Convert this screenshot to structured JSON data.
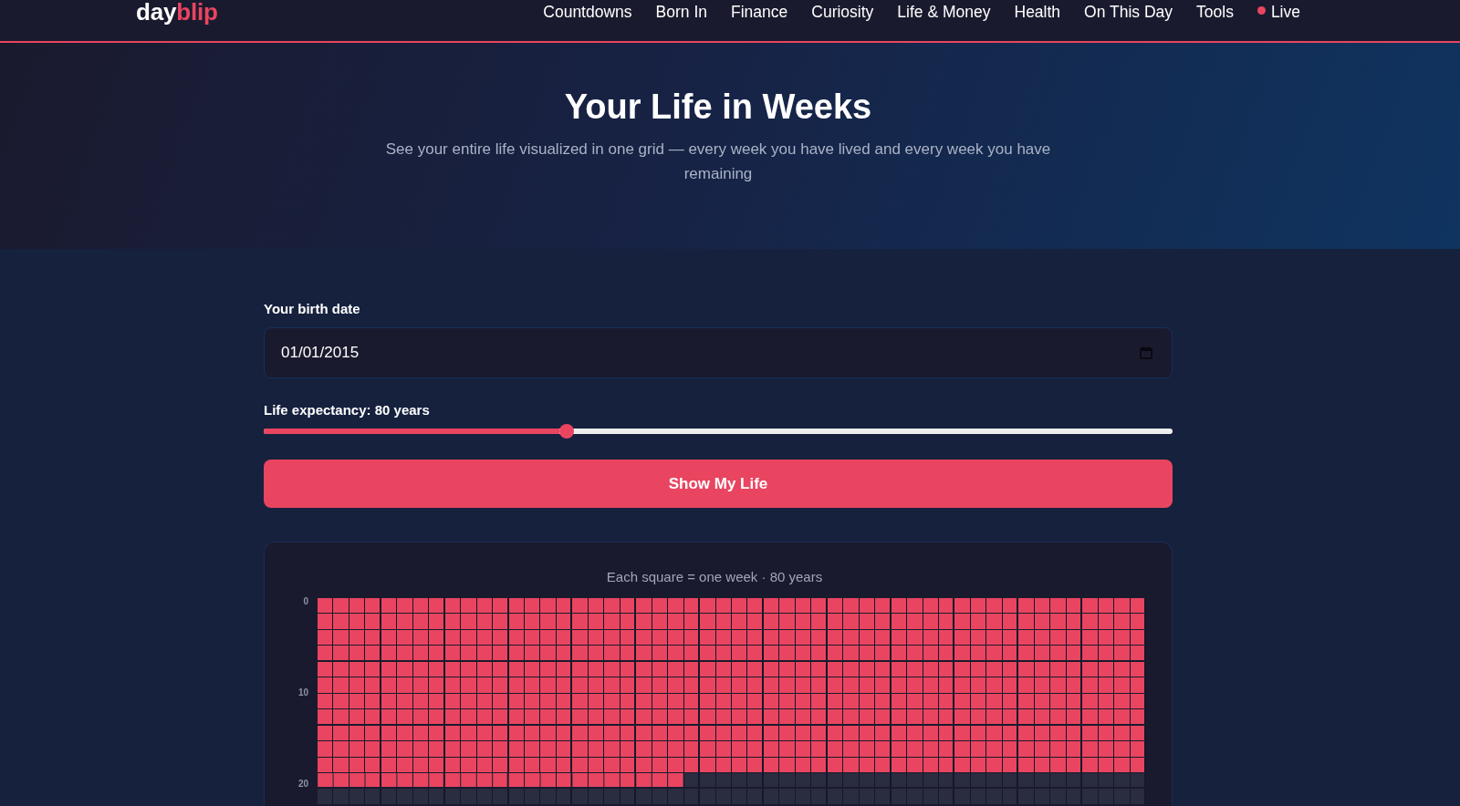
{
  "header": {
    "logo": {
      "lead": "day",
      "accent": "blip"
    },
    "nav": [
      {
        "label": "Countdowns",
        "kind": "link"
      },
      {
        "label": "Born In",
        "kind": "link"
      },
      {
        "label": "Finance",
        "kind": "link"
      },
      {
        "label": "Curiosity",
        "kind": "link"
      },
      {
        "label": "Life & Money",
        "kind": "link"
      },
      {
        "label": "Health",
        "kind": "link"
      },
      {
        "label": "On This Day",
        "kind": "link"
      },
      {
        "label": "Tools",
        "kind": "link"
      },
      {
        "label": "Live",
        "kind": "live"
      }
    ]
  },
  "hero": {
    "title": "Your Life in Weeks",
    "subtitle": "See your entire life visualized in one grid — every week you have lived and every week you have remaining"
  },
  "form": {
    "birth_date": {
      "label": "Your birth date",
      "value": "01/01/2015"
    },
    "life_expectancy": {
      "label": "Life expectancy: 80 years",
      "level": 0.333
    },
    "submit_button": {
      "label": "Show My Life"
    }
  },
  "life_grid": {
    "caption": "Each square = one week · 80 years",
    "row_labels": [
      "0",
      "10",
      "20"
    ],
    "rows": [
      {
        "kind": "lived"
      },
      {
        "kind": "lived"
      },
      {
        "kind": "lived"
      },
      {
        "kind": "lived"
      },
      {
        "kind": "lived"
      },
      {
        "kind": "lived"
      },
      {
        "kind": "lived"
      },
      {
        "kind": "lived"
      },
      {
        "kind": "lived"
      },
      {
        "kind": "lived"
      },
      {
        "kind": "lived"
      },
      {
        "kind": "current",
        "level": 0.442
      },
      {
        "kind": "remaining"
      }
    ]
  }
}
